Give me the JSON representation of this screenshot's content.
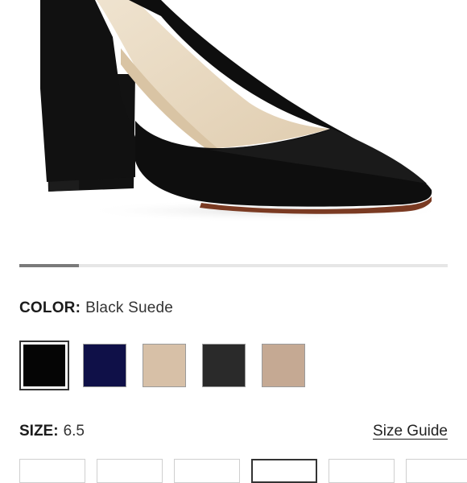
{
  "product": {
    "image": {
      "alt": "Black suede pointed-toe block heel pump"
    },
    "gallery": {
      "active_index": 0,
      "progress": 0.14
    }
  },
  "color": {
    "label": "COLOR:",
    "selected_value": "Black Suede",
    "swatches": [
      {
        "name": "Black Suede",
        "hex": "#050505",
        "selected": true
      },
      {
        "name": "Navy",
        "hex": "#0f1048",
        "selected": false
      },
      {
        "name": "Nude",
        "hex": "#d7c0a7",
        "selected": false
      },
      {
        "name": "Black",
        "hex": "#2a2a2a",
        "selected": false
      },
      {
        "name": "Taupe",
        "hex": "#c5a993",
        "selected": false
      }
    ]
  },
  "size": {
    "label": "SIZE:",
    "selected_value": "6.5",
    "guide_link": "Size Guide",
    "options_visible": 6
  },
  "colors": {
    "accent": "#333333",
    "track": "#e6e6e6",
    "thumb": "#7a7a7a"
  }
}
